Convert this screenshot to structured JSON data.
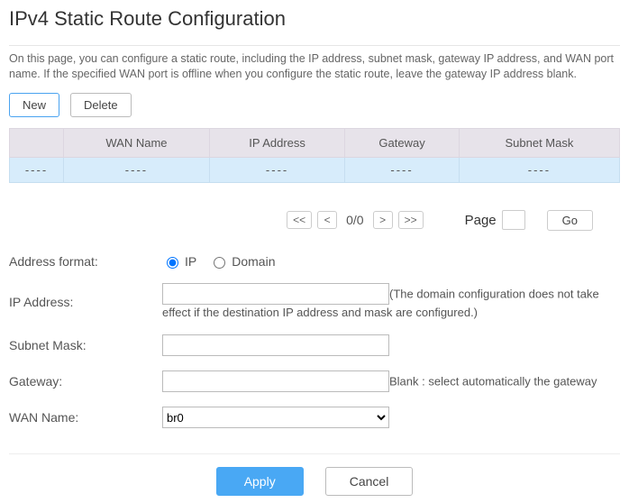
{
  "header": {
    "title": "IPv4 Static Route Configuration"
  },
  "description": "On this page, you can configure a static route, including the IP address, subnet mask, gateway IP address, and WAN port name. If the specified WAN port is offline when you configure the static route, leave the gateway IP address blank.",
  "buttons": {
    "new": "New",
    "delete": "Delete"
  },
  "table": {
    "headers": {
      "sel": "",
      "wan": "WAN Name",
      "ip": "IP Address",
      "gw": "Gateway",
      "mask": "Subnet Mask"
    },
    "empty_cell": "----"
  },
  "pager": {
    "first": "<<",
    "prev": "<",
    "status": "0/0",
    "next": ">",
    "last": ">>",
    "page_label": "Page",
    "page_value": "",
    "go": "Go"
  },
  "form": {
    "addr_format_label": "Address format:",
    "addr_format_ip": "IP",
    "addr_format_domain": "Domain",
    "ip_label": "IP Address:",
    "ip_value": "",
    "ip_hint": "(The domain configuration does not take effect if the destination IP address and mask are configured.)",
    "mask_label": "Subnet Mask:",
    "mask_value": "",
    "gw_label": "Gateway:",
    "gw_value": "",
    "gw_hint": "Blank : select automatically the gateway",
    "wan_label": "WAN Name:",
    "wan_options": [
      "br0"
    ],
    "wan_selected": "br0"
  },
  "actions": {
    "apply": "Apply",
    "cancel": "Cancel"
  }
}
